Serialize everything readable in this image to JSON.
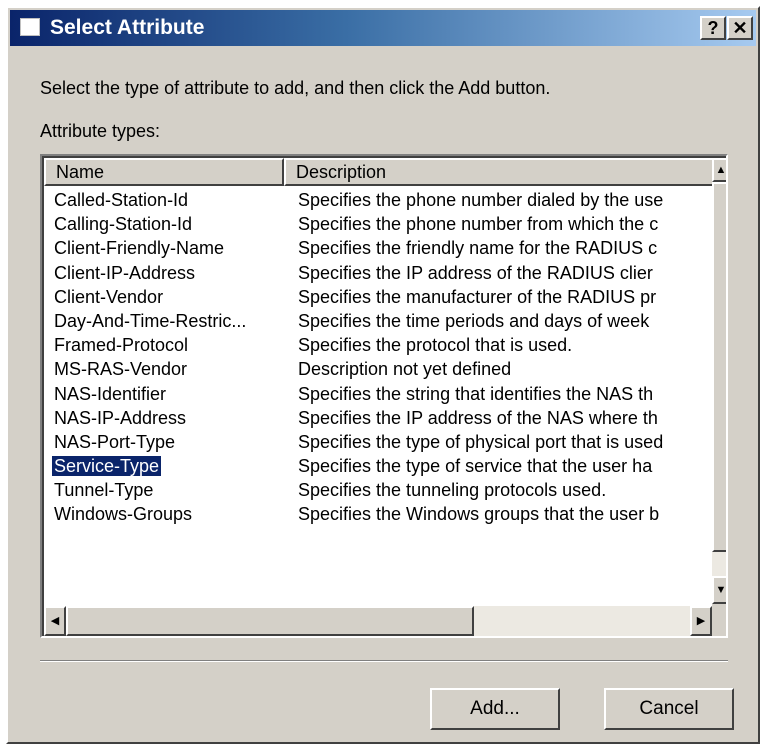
{
  "window": {
    "title": "Select Attribute",
    "help_label": "?",
    "close_label": "✕"
  },
  "instruction": "Select the type of attribute to add, and then click the Add button.",
  "list_label": "Attribute types:",
  "columns": {
    "name": "Name",
    "description": "Description"
  },
  "rows": [
    {
      "name": "Called-Station-Id",
      "description": "Specifies the phone number dialed by the use"
    },
    {
      "name": "Calling-Station-Id",
      "description": "Specifies the phone number from which the c"
    },
    {
      "name": "Client-Friendly-Name",
      "description": "Specifies the friendly name for the RADIUS c"
    },
    {
      "name": "Client-IP-Address",
      "description": "Specifies the IP address of the RADIUS clier"
    },
    {
      "name": "Client-Vendor",
      "description": "Specifies the manufacturer of the RADIUS pr"
    },
    {
      "name": "Day-And-Time-Restric...",
      "description": "Specifies the time periods and days of week"
    },
    {
      "name": "Framed-Protocol",
      "description": "Specifies the protocol that is used."
    },
    {
      "name": "MS-RAS-Vendor",
      "description": "Description not yet defined"
    },
    {
      "name": "NAS-Identifier",
      "description": "Specifies the string that identifies the NAS th"
    },
    {
      "name": "NAS-IP-Address",
      "description": "Specifies the IP address of the NAS where th"
    },
    {
      "name": "NAS-Port-Type",
      "description": "Specifies the type of physical port that is used"
    },
    {
      "name": "Service-Type",
      "description": "Specifies the type of service that the user ha"
    },
    {
      "name": "Tunnel-Type",
      "description": "Specifies the tunneling protocols used."
    },
    {
      "name": "Windows-Groups",
      "description": "Specifies the Windows groups that the user b"
    }
  ],
  "selected_row": "Service-Type",
  "scroll_arrows": {
    "up": "▲",
    "down": "▼",
    "left": "◀",
    "right": "▶"
  },
  "buttons": {
    "add": "Add...",
    "cancel": "Cancel"
  },
  "colors": {
    "title_bar": "#0a246a",
    "selection": "#0a246a",
    "face": "#d4d0c8"
  }
}
